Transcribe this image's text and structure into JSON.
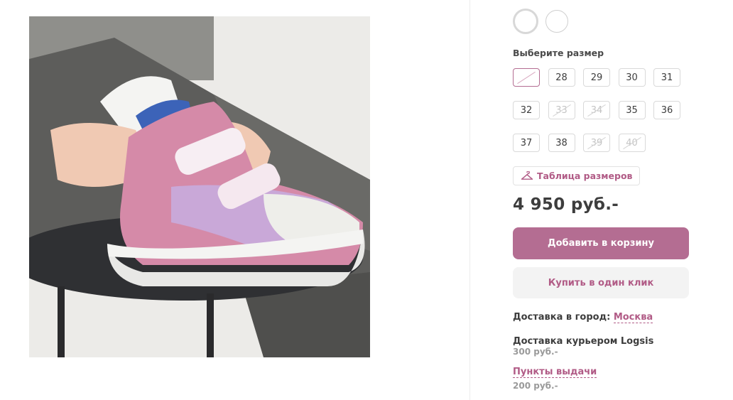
{
  "product": {
    "image_alt": "pink-sneaker-photo",
    "price": "4 950 руб.-"
  },
  "colors": [
    {
      "name": "white",
      "hex": "#ffffff",
      "selected": true
    },
    {
      "name": "white",
      "hex": "#ffffff",
      "selected": false
    }
  ],
  "sizes": {
    "title": "Выберите размер",
    "items": [
      {
        "label": "",
        "available": false,
        "selected": true
      },
      {
        "label": "28",
        "available": true
      },
      {
        "label": "29",
        "available": true
      },
      {
        "label": "30",
        "available": true
      },
      {
        "label": "31",
        "available": true
      },
      {
        "label": "32",
        "available": true
      },
      {
        "label": "33",
        "available": false
      },
      {
        "label": "34",
        "available": false
      },
      {
        "label": "35",
        "available": true
      },
      {
        "label": "36",
        "available": true
      },
      {
        "label": "37",
        "available": true
      },
      {
        "label": "38",
        "available": true
      },
      {
        "label": "39",
        "available": false
      },
      {
        "label": "40",
        "available": false
      }
    ],
    "table_label": "Таблица размеров",
    "table_icon": "hanger-icon"
  },
  "actions": {
    "add_to_cart": "Добавить в корзину",
    "buy_one_click": "Купить в один клик"
  },
  "delivery": {
    "city_label": "Доставка в город:",
    "city": "Москва",
    "courier_name": "Доставка курьером Logsis",
    "courier_price": "300 руб.-",
    "pickup_label": "Пункты выдачи",
    "pickup_price": "200 руб.-"
  },
  "theme": {
    "accent": "#b46d92",
    "accent_text": "#b15b86",
    "muted": "#9a9a9a"
  }
}
